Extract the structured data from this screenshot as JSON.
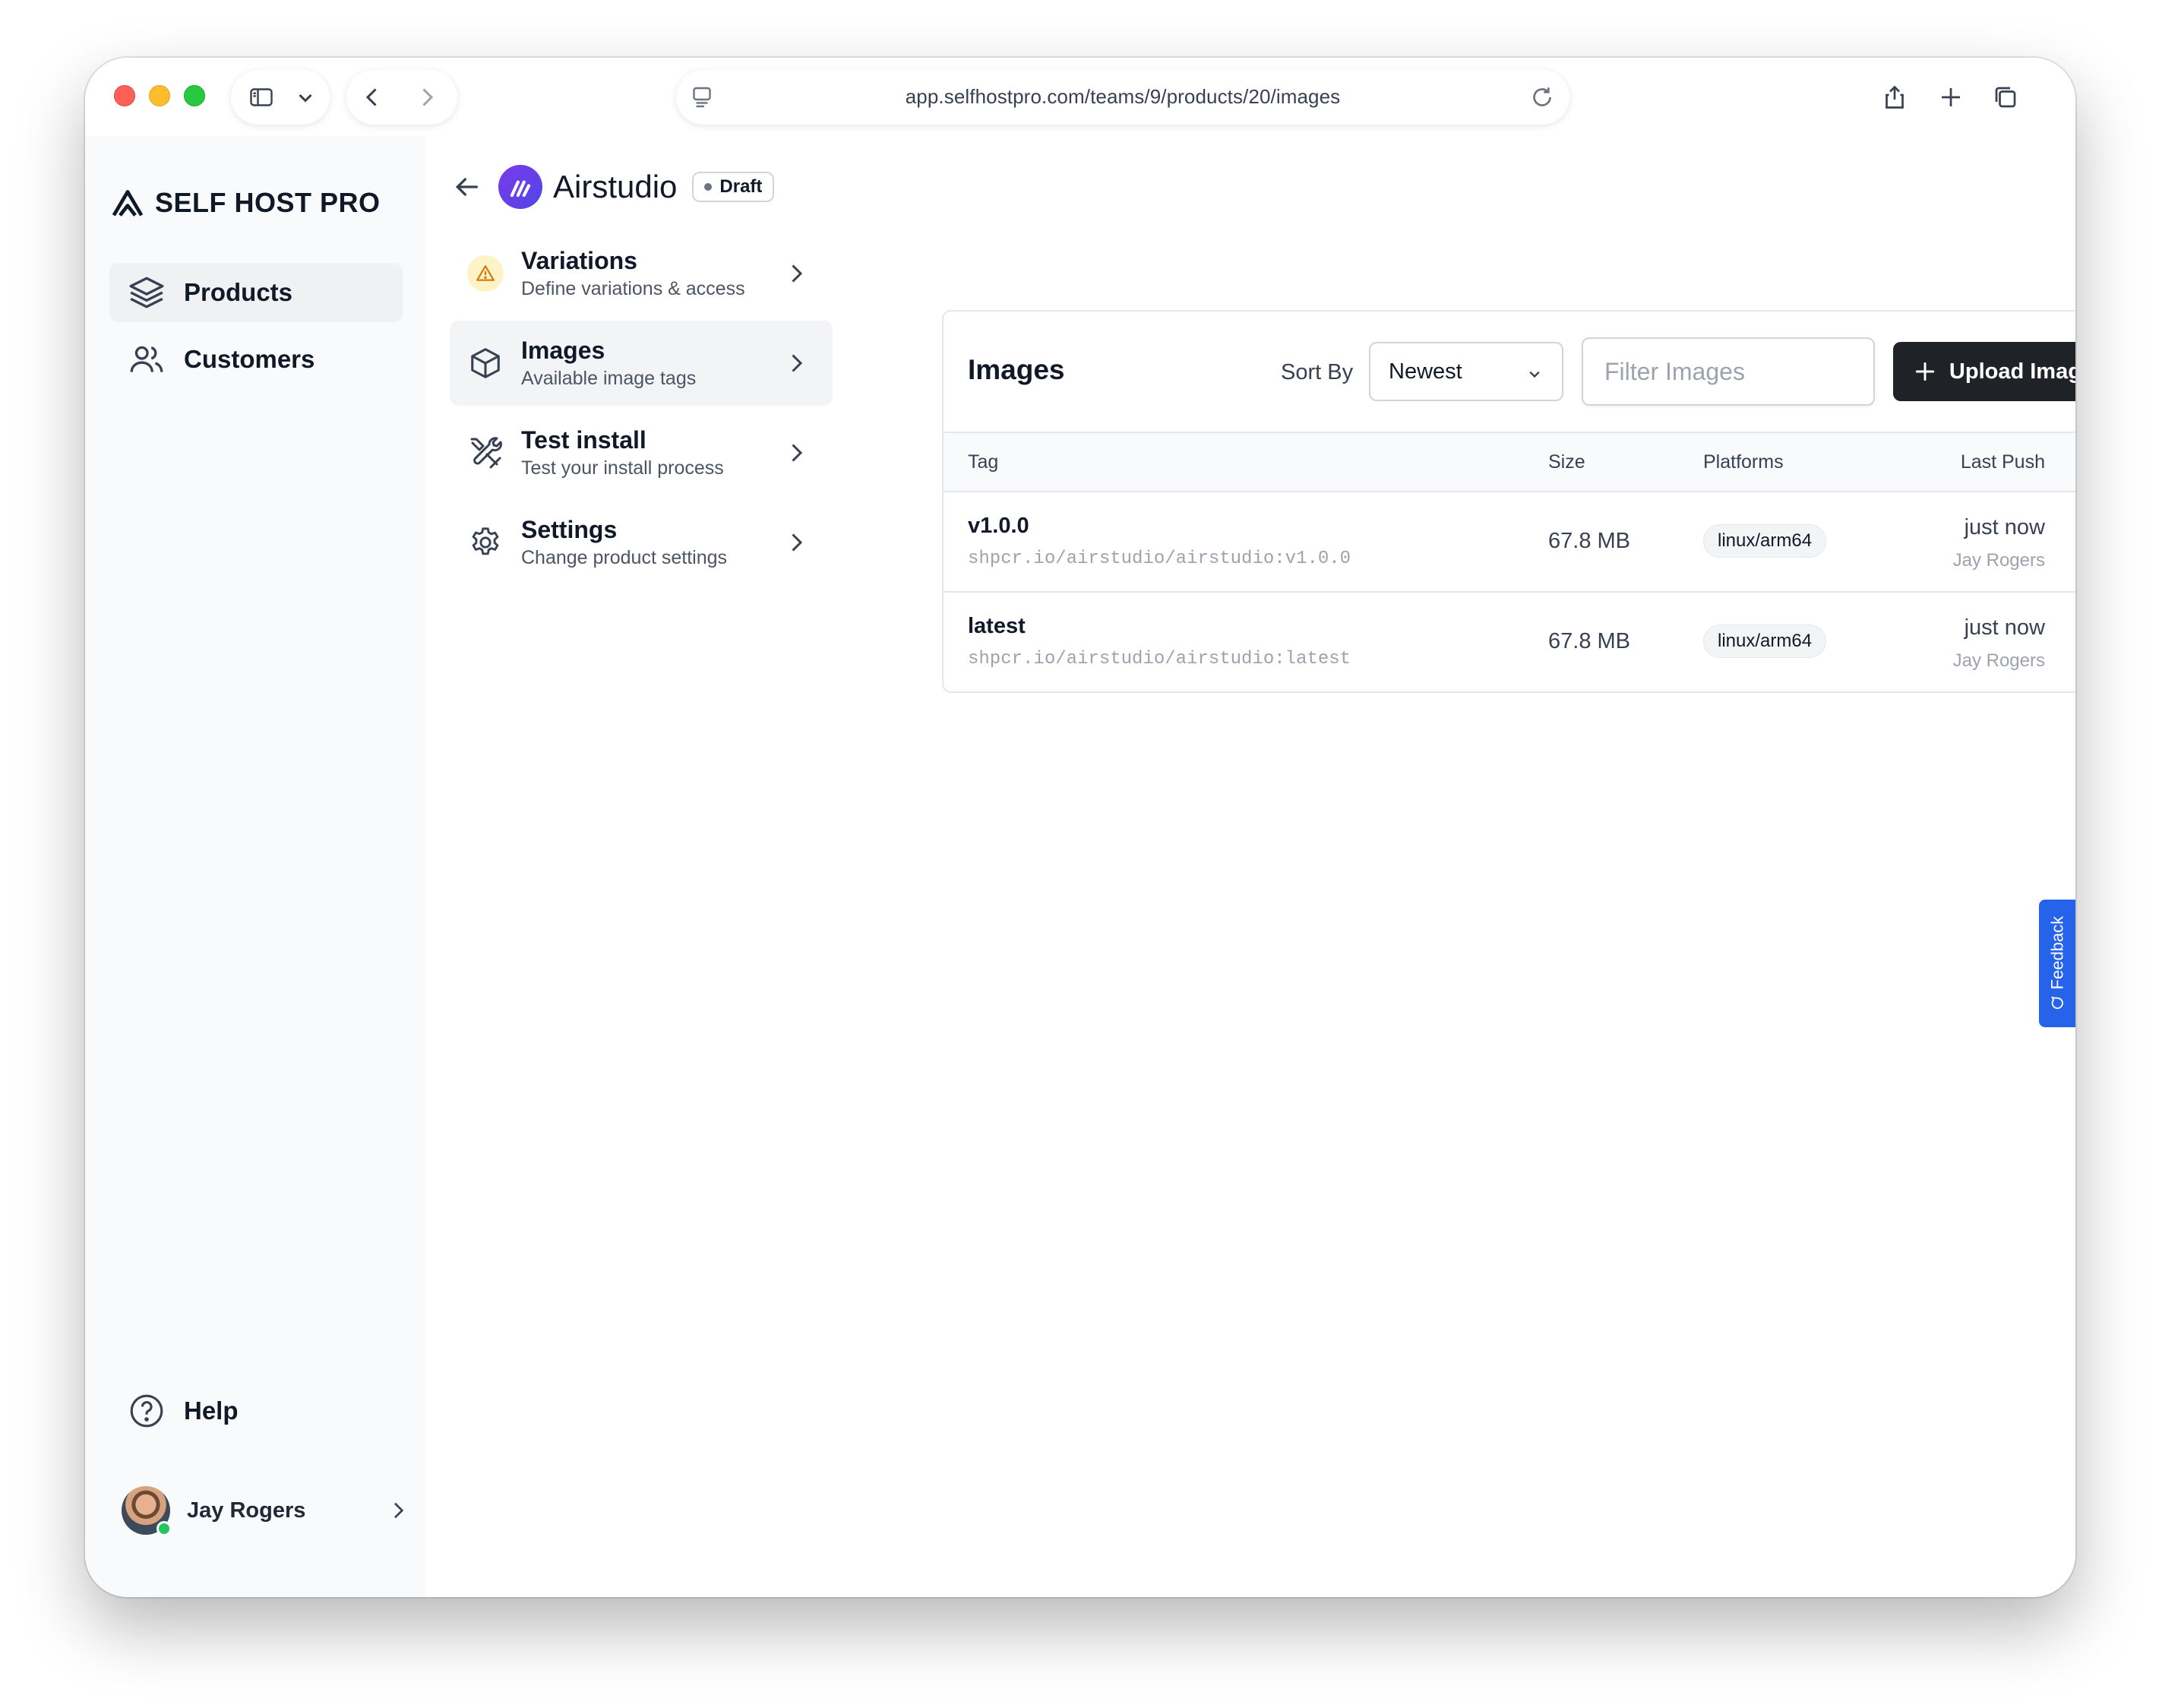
{
  "browser": {
    "url": "app.selfhostpro.com/teams/9/products/20/images"
  },
  "sidebar": {
    "brand": "SELF HOST PRO",
    "items": [
      {
        "label": "Products",
        "icon": "layers-icon",
        "active": true
      },
      {
        "label": "Customers",
        "icon": "users-icon",
        "active": false
      }
    ],
    "help_label": "Help",
    "user_name": "Jay Rogers"
  },
  "product": {
    "name": "Airstudio",
    "status": "Draft"
  },
  "subnav": [
    {
      "title": "Variations",
      "desc": "Define variations & access",
      "icon": "warning-icon",
      "active": false
    },
    {
      "title": "Images",
      "desc": "Available image tags",
      "icon": "cube-icon",
      "active": true
    },
    {
      "title": "Test install",
      "desc": "Test your install process",
      "icon": "tools-icon",
      "active": false
    },
    {
      "title": "Settings",
      "desc": "Change product settings",
      "icon": "gear-icon",
      "active": false
    }
  ],
  "images": {
    "title": "Images",
    "sort_label": "Sort By",
    "sort_value": "Newest",
    "filter_placeholder": "Filter Images",
    "upload_label": "Upload Image",
    "columns": {
      "tag": "Tag",
      "size": "Size",
      "platforms": "Platforms",
      "last_push": "Last Push"
    },
    "rows": [
      {
        "tag": "v1.0.0",
        "path": "shpcr.io/airstudio/airstudio:v1.0.0",
        "size": "67.8 MB",
        "platform": "linux/arm64",
        "pushed": "just now",
        "pushed_by": "Jay Rogers"
      },
      {
        "tag": "latest",
        "path": "shpcr.io/airstudio/airstudio:latest",
        "size": "67.8 MB",
        "platform": "linux/arm64",
        "pushed": "just now",
        "pushed_by": "Jay Rogers"
      }
    ]
  },
  "feedback_label": "Feedback",
  "colors": {
    "accent_dark": "#1f2328",
    "feedback_blue": "#2563eb",
    "warning_bg": "#fef3c7",
    "product_logo": "#6d3fe8"
  }
}
